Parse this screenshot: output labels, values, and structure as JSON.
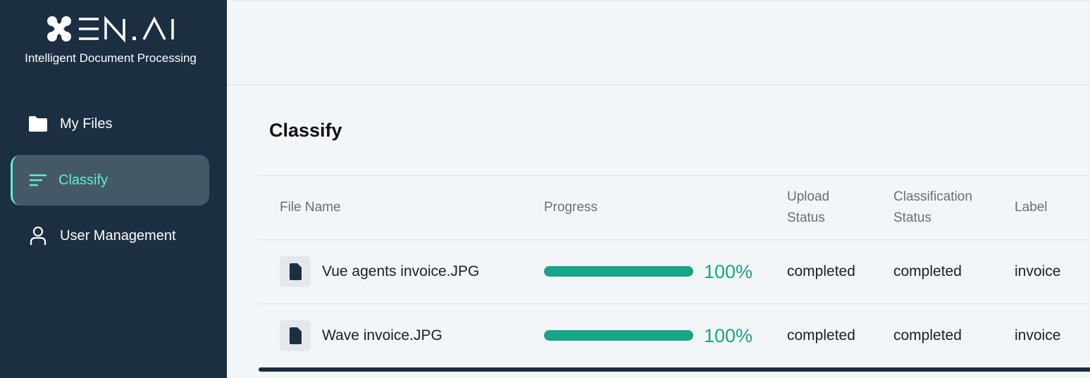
{
  "sidebar": {
    "logo_text": "XEN.AI",
    "tagline": "Intelligent Document Processing",
    "items": [
      {
        "label": "My Files",
        "icon": "folder-icon",
        "active": false
      },
      {
        "label": "Classify",
        "icon": "list-icon",
        "active": true
      },
      {
        "label": "User Management",
        "icon": "user-icon",
        "active": false
      }
    ]
  },
  "main": {
    "title": "Classify",
    "columns": {
      "file_name": "File Name",
      "progress": "Progress",
      "upload_status_line1": "Upload",
      "upload_status_line2": "Status",
      "classification_status_line1": "Classification",
      "classification_status_line2": "Status",
      "label": "Label"
    },
    "rows": [
      {
        "file_name": "Vue agents invoice.JPG",
        "progress": 100,
        "progress_text": "100%",
        "upload_status": "completed",
        "classification_status": "completed",
        "label": "invoice"
      },
      {
        "file_name": "Wave invoice.JPG",
        "progress": 100,
        "progress_text": "100%",
        "upload_status": "completed",
        "classification_status": "completed",
        "label": "invoice"
      }
    ]
  },
  "colors": {
    "sidebar_bg": "#1b2e42",
    "accent": "#5ff0d0",
    "progress": "#17a488"
  }
}
